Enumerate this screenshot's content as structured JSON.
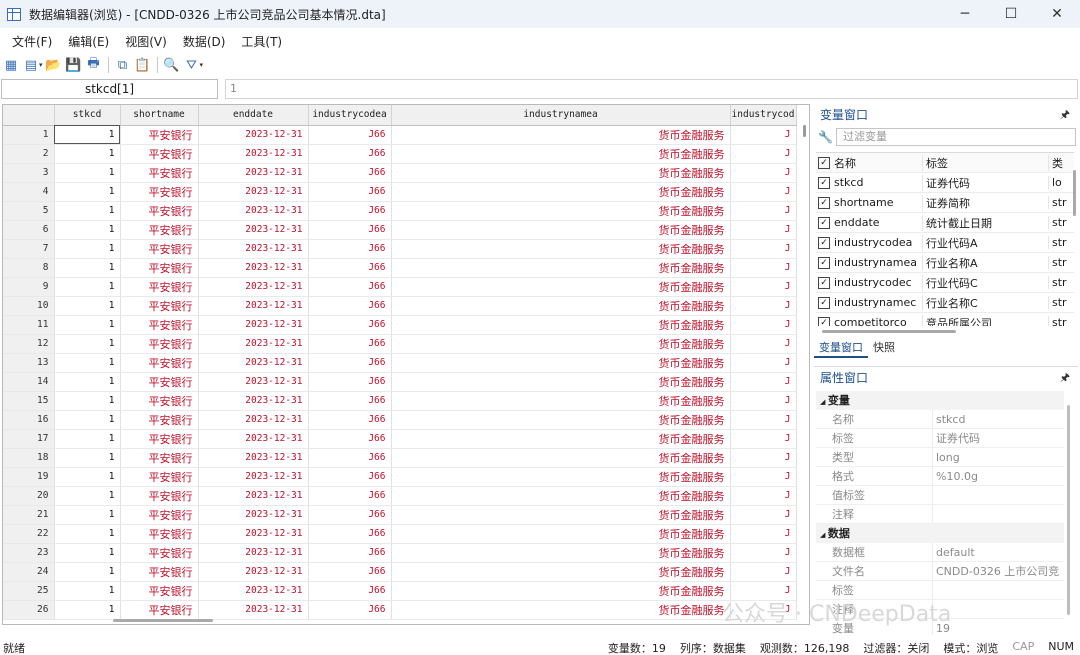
{
  "window": {
    "title": "数据编辑器(浏览) - [CNDD-0326 上市公司竞品公司基本情况.dta]",
    "buttons": {
      "minimize": "─",
      "maximize": "☐",
      "close": "✕"
    }
  },
  "menu": [
    "文件(F)",
    "编辑(E)",
    "视图(V)",
    "数据(D)",
    "工具(T)"
  ],
  "toolbar": {
    "icons": [
      "table-icon",
      "table-view-icon",
      "open-folder-icon",
      "save-icon",
      "print-icon",
      "copy-icon",
      "paste-icon",
      "search-icon",
      "filter-icon"
    ],
    "glyphs": {
      "table": "▦",
      "view": "▤",
      "open": "📂",
      "save": "💾",
      "print": "🖶",
      "copy": "⧉",
      "paste": "📋",
      "search": "🔍",
      "filter": "⛛",
      "dropdown": "▾"
    }
  },
  "cellref": {
    "name": "stkcd[1]",
    "value": "1"
  },
  "grid": {
    "columns": [
      "stkcd",
      "shortname",
      "enddate",
      "industrycodea",
      "industrynamea",
      "industrycod"
    ],
    "row_count_visible": 26,
    "rows": [
      {
        "n": "1",
        "stkcd": "1",
        "shortname": "平安银行",
        "enddate": "2023-12-31",
        "industrycodea": "J66",
        "industrynamea": "货币金融服务",
        "industrycod": "J"
      },
      {
        "n": "2",
        "stkcd": "1",
        "shortname": "平安银行",
        "enddate": "2023-12-31",
        "industrycodea": "J66",
        "industrynamea": "货币金融服务",
        "industrycod": "J"
      },
      {
        "n": "3",
        "stkcd": "1",
        "shortname": "平安银行",
        "enddate": "2023-12-31",
        "industrycodea": "J66",
        "industrynamea": "货币金融服务",
        "industrycod": "J"
      },
      {
        "n": "4",
        "stkcd": "1",
        "shortname": "平安银行",
        "enddate": "2023-12-31",
        "industrycodea": "J66",
        "industrynamea": "货币金融服务",
        "industrycod": "J"
      },
      {
        "n": "5",
        "stkcd": "1",
        "shortname": "平安银行",
        "enddate": "2023-12-31",
        "industrycodea": "J66",
        "industrynamea": "货币金融服务",
        "industrycod": "J"
      },
      {
        "n": "6",
        "stkcd": "1",
        "shortname": "平安银行",
        "enddate": "2023-12-31",
        "industrycodea": "J66",
        "industrynamea": "货币金融服务",
        "industrycod": "J"
      },
      {
        "n": "7",
        "stkcd": "1",
        "shortname": "平安银行",
        "enddate": "2023-12-31",
        "industrycodea": "J66",
        "industrynamea": "货币金融服务",
        "industrycod": "J"
      },
      {
        "n": "8",
        "stkcd": "1",
        "shortname": "平安银行",
        "enddate": "2023-12-31",
        "industrycodea": "J66",
        "industrynamea": "货币金融服务",
        "industrycod": "J"
      },
      {
        "n": "9",
        "stkcd": "1",
        "shortname": "平安银行",
        "enddate": "2023-12-31",
        "industrycodea": "J66",
        "industrynamea": "货币金融服务",
        "industrycod": "J"
      },
      {
        "n": "10",
        "stkcd": "1",
        "shortname": "平安银行",
        "enddate": "2023-12-31",
        "industrycodea": "J66",
        "industrynamea": "货币金融服务",
        "industrycod": "J"
      },
      {
        "n": "11",
        "stkcd": "1",
        "shortname": "平安银行",
        "enddate": "2023-12-31",
        "industrycodea": "J66",
        "industrynamea": "货币金融服务",
        "industrycod": "J"
      },
      {
        "n": "12",
        "stkcd": "1",
        "shortname": "平安银行",
        "enddate": "2023-12-31",
        "industrycodea": "J66",
        "industrynamea": "货币金融服务",
        "industrycod": "J"
      },
      {
        "n": "13",
        "stkcd": "1",
        "shortname": "平安银行",
        "enddate": "2023-12-31",
        "industrycodea": "J66",
        "industrynamea": "货币金融服务",
        "industrycod": "J"
      },
      {
        "n": "14",
        "stkcd": "1",
        "shortname": "平安银行",
        "enddate": "2023-12-31",
        "industrycodea": "J66",
        "industrynamea": "货币金融服务",
        "industrycod": "J"
      },
      {
        "n": "15",
        "stkcd": "1",
        "shortname": "平安银行",
        "enddate": "2023-12-31",
        "industrycodea": "J66",
        "industrynamea": "货币金融服务",
        "industrycod": "J"
      },
      {
        "n": "16",
        "stkcd": "1",
        "shortname": "平安银行",
        "enddate": "2023-12-31",
        "industrycodea": "J66",
        "industrynamea": "货币金融服务",
        "industrycod": "J"
      },
      {
        "n": "17",
        "stkcd": "1",
        "shortname": "平安银行",
        "enddate": "2023-12-31",
        "industrycodea": "J66",
        "industrynamea": "货币金融服务",
        "industrycod": "J"
      },
      {
        "n": "18",
        "stkcd": "1",
        "shortname": "平安银行",
        "enddate": "2023-12-31",
        "industrycodea": "J66",
        "industrynamea": "货币金融服务",
        "industrycod": "J"
      },
      {
        "n": "19",
        "stkcd": "1",
        "shortname": "平安银行",
        "enddate": "2023-12-31",
        "industrycodea": "J66",
        "industrynamea": "货币金融服务",
        "industrycod": "J"
      },
      {
        "n": "20",
        "stkcd": "1",
        "shortname": "平安银行",
        "enddate": "2023-12-31",
        "industrycodea": "J66",
        "industrynamea": "货币金融服务",
        "industrycod": "J"
      },
      {
        "n": "21",
        "stkcd": "1",
        "shortname": "平安银行",
        "enddate": "2023-12-31",
        "industrycodea": "J66",
        "industrynamea": "货币金融服务",
        "industrycod": "J"
      },
      {
        "n": "22",
        "stkcd": "1",
        "shortname": "平安银行",
        "enddate": "2023-12-31",
        "industrycodea": "J66",
        "industrynamea": "货币金融服务",
        "industrycod": "J"
      },
      {
        "n": "23",
        "stkcd": "1",
        "shortname": "平安银行",
        "enddate": "2023-12-31",
        "industrycodea": "J66",
        "industrynamea": "货币金融服务",
        "industrycod": "J"
      },
      {
        "n": "24",
        "stkcd": "1",
        "shortname": "平安银行",
        "enddate": "2023-12-31",
        "industrycodea": "J66",
        "industrynamea": "货币金融服务",
        "industrycod": "J"
      },
      {
        "n": "25",
        "stkcd": "1",
        "shortname": "平安银行",
        "enddate": "2023-12-31",
        "industrycodea": "J66",
        "industrynamea": "货币金融服务",
        "industrycod": "J"
      },
      {
        "n": "26",
        "stkcd": "1",
        "shortname": "平安银行",
        "enddate": "2023-12-31",
        "industrycodea": "J66",
        "industrynamea": "货币金融服务",
        "industrycod": "J"
      }
    ],
    "string_color": "#c0112b"
  },
  "variables_pane": {
    "title": "变量窗口",
    "pin": "🖈",
    "filter_placeholder": "过滤变量",
    "headers": {
      "name": "名称",
      "label": "标签",
      "type": "类"
    },
    "rows": [
      {
        "name": "stkcd",
        "label": "证券代码",
        "type": "lo"
      },
      {
        "name": "shortname",
        "label": "证券简称",
        "type": "str"
      },
      {
        "name": "enddate",
        "label": "统计截止日期",
        "type": "str"
      },
      {
        "name": "industrycodea",
        "label": "行业代码A",
        "type": "str"
      },
      {
        "name": "industrynamea",
        "label": "行业名称A",
        "type": "str"
      },
      {
        "name": "industrycodec",
        "label": "行业代码C",
        "type": "str"
      },
      {
        "name": "industrynamec",
        "label": "行业名称C",
        "type": "str"
      },
      {
        "name": "competitorco",
        "label": "竞品所属公司",
        "type": "str"
      }
    ],
    "tabs": [
      "变量窗口",
      "快照"
    ]
  },
  "properties_pane": {
    "title": "属性窗口",
    "pin": "🖈",
    "sections": [
      {
        "title": "变量",
        "rows": [
          {
            "key": "名称",
            "value": "stkcd"
          },
          {
            "key": "标签",
            "value": "证券代码"
          },
          {
            "key": "类型",
            "value": "long"
          },
          {
            "key": "格式",
            "value": "%10.0g"
          },
          {
            "key": "值标签",
            "value": ""
          },
          {
            "key": "注释",
            "value": ""
          }
        ]
      },
      {
        "title": "数据",
        "rows": [
          {
            "key": "数据框",
            "value": "default"
          },
          {
            "key": "文件名",
            "value": "CNDD-0326 上市公司竞"
          },
          {
            "key": "标签",
            "value": ""
          },
          {
            "key": "注释",
            "value": ""
          },
          {
            "key": "变量",
            "value": "19"
          }
        ]
      }
    ]
  },
  "watermark": "公众号 · CNDeepData",
  "status": {
    "ready": "就绪",
    "vars": "变量数：19",
    "order": "列序：数据集",
    "obs": "观测数：126,198",
    "filter": "过滤器：关闭",
    "mode": "模式：浏览",
    "cap": "CAP",
    "num": "NUM"
  }
}
